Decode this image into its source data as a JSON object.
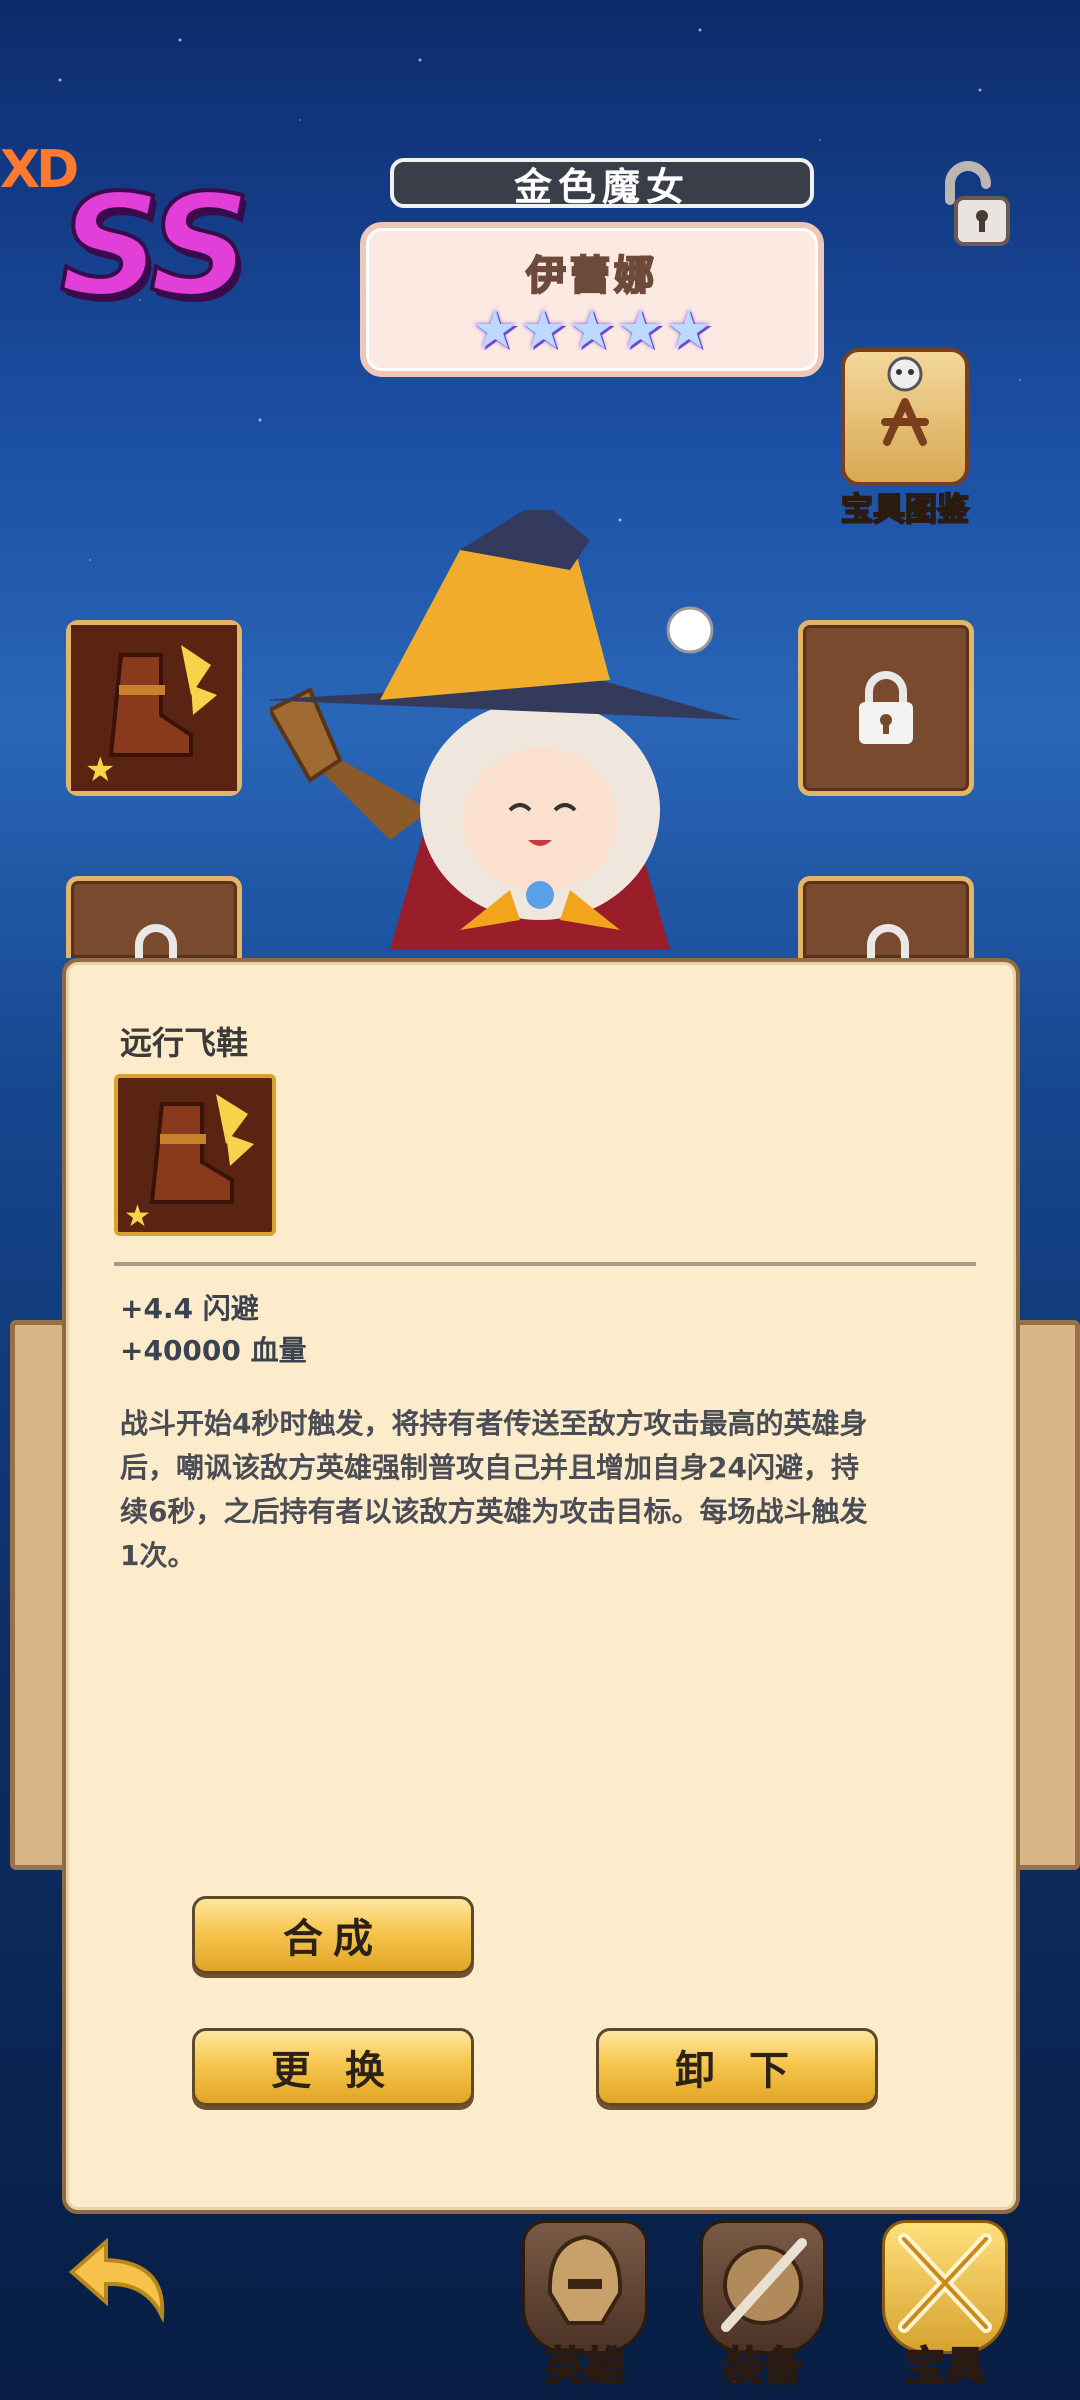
{
  "header": {
    "corner_logo": "XD",
    "rank": "SS",
    "hero_title": "金色魔女",
    "hero_name": "伊蕾娜",
    "star_count": 5
  },
  "codex": {
    "label": "宝具图鉴"
  },
  "item": {
    "name": "远行飞鞋",
    "stats": [
      "+4.4 闪避",
      "+40000 血量"
    ],
    "description": "战斗开始4秒时触发，将持有者传送至敌方攻击最高的英雄身后，嘲讽该敌方英雄强制普攻自己并且增加自身24闪避，持续6秒，之后持有者以该敌方英雄为攻击目标。每场战斗触发1次。"
  },
  "actions": {
    "combine": "合成",
    "replace": "更 换",
    "unequip": "卸 下"
  },
  "tabs": [
    {
      "label": "英雄",
      "icon": "helmet-icon",
      "active": false
    },
    {
      "label": "装备",
      "icon": "shield-sword-icon",
      "active": false
    },
    {
      "label": "宝具",
      "icon": "crossed-swords-icon",
      "active": true
    }
  ],
  "colors": {
    "panel_bg": "#fdeccb",
    "button_gold": "#f6c64e",
    "rank_magenta": "#e23fd8"
  }
}
